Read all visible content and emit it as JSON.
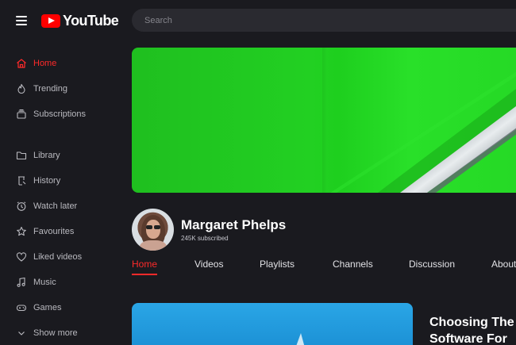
{
  "header": {
    "logo_text": "YouTube",
    "search_placeholder": "Search"
  },
  "sidebar": {
    "items": [
      {
        "label": "Home",
        "icon": "home-icon",
        "active": true
      },
      {
        "label": "Trending",
        "icon": "flame-icon"
      },
      {
        "label": "Subscriptions",
        "icon": "subscriptions-icon"
      },
      {
        "label": "Library",
        "icon": "folder-icon"
      },
      {
        "label": "History",
        "icon": "history-icon"
      },
      {
        "label": "Watch later",
        "icon": "clock-icon"
      },
      {
        "label": "Favourites",
        "icon": "star-icon"
      },
      {
        "label": "Liked videos",
        "icon": "heart-icon"
      },
      {
        "label": "Music",
        "icon": "music-icon"
      },
      {
        "label": "Games",
        "icon": "gamepad-icon"
      },
      {
        "label": "Show more",
        "icon": "chevron-down-icon"
      }
    ]
  },
  "channel": {
    "name": "Margaret Phelps",
    "subscribers": "245K subscribed"
  },
  "tabs": [
    {
      "label": "Home",
      "active": true
    },
    {
      "label": "Videos"
    },
    {
      "label": "Playlists"
    },
    {
      "label": "Channels"
    },
    {
      "label": "Discussion"
    },
    {
      "label": "About"
    }
  ],
  "video": {
    "title_line1": "Choosing The",
    "title_line2": "Software For"
  },
  "colors": {
    "accent": "#ff2a2a",
    "background": "#1a1a1f",
    "banner_green": "#22d022"
  }
}
